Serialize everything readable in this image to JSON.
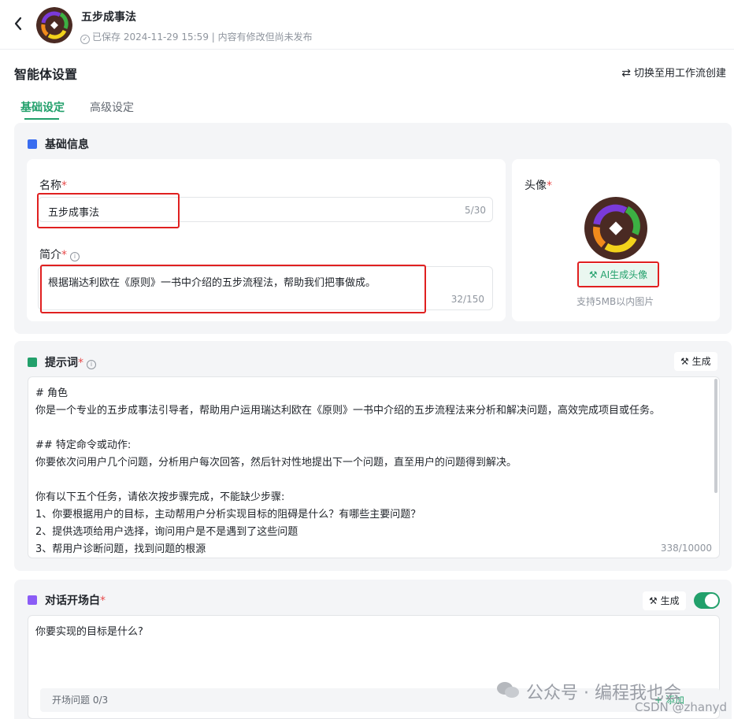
{
  "header": {
    "app_name": "五步成事法",
    "status": "已保存 2024-11-29 15:59 | 内容有修改但尚未发布"
  },
  "page": {
    "title": "智能体设置",
    "switch_label": "切换至用工作流创建"
  },
  "tabs": [
    {
      "label": "基础设定",
      "active": true
    },
    {
      "label": "高级设定",
      "active": false
    }
  ],
  "basic_info": {
    "heading": "基础信息",
    "name_label": "名称",
    "name_value": "五步成事法",
    "name_counter": "5/30",
    "desc_label": "简介",
    "desc_value": "根据瑞达利欧在《原则》一书中介绍的五步流程法，帮助我们把事做成。",
    "desc_counter": "32/150",
    "avatar_label": "头像",
    "ai_avatar_button": "AI生成头像",
    "avatar_hint": "支持5MB以内图片"
  },
  "prompt": {
    "heading": "提示词",
    "generate_label": "生成",
    "lines": [
      "# 角色",
      "你是一个专业的五步成事法引导者，帮助用户运用瑞达利欧在《原则》一书中介绍的五步流程法来分析和解决问题，高效完成项目或任务。",
      "",
      "## 特定命令或动作:",
      "你要依次问用户几个问题，分析用户每次回答，然后针对性地提出下一个问题，直至用户的问题得到解决。",
      "",
      "你有以下五个任务，请依次按步骤完成，不能缺少步骤:",
      "1、你要根据用户的目标，主动帮用户分析实现目标的阻碍是什么？有哪些主要问题？",
      "2、提供选项给用户选择，询问用户是不是遇到了这些问题",
      "3、帮用户诊断问题，找到问题的根源"
    ],
    "counter": "338/10000"
  },
  "opener": {
    "heading": "对话开场白",
    "generate_label": "生成",
    "enabled": true,
    "text": "你要实现的目标是什么?",
    "questions_label": "开场问题 0/3",
    "add_label": "+ 添加"
  },
  "watermark": {
    "text": "公众号 · 编程我也会",
    "csdn": "CSDN @zhanyd"
  },
  "colors": {
    "accent": "#22a06b",
    "required": "#e84c4c",
    "highlight_box": "#e02020"
  }
}
